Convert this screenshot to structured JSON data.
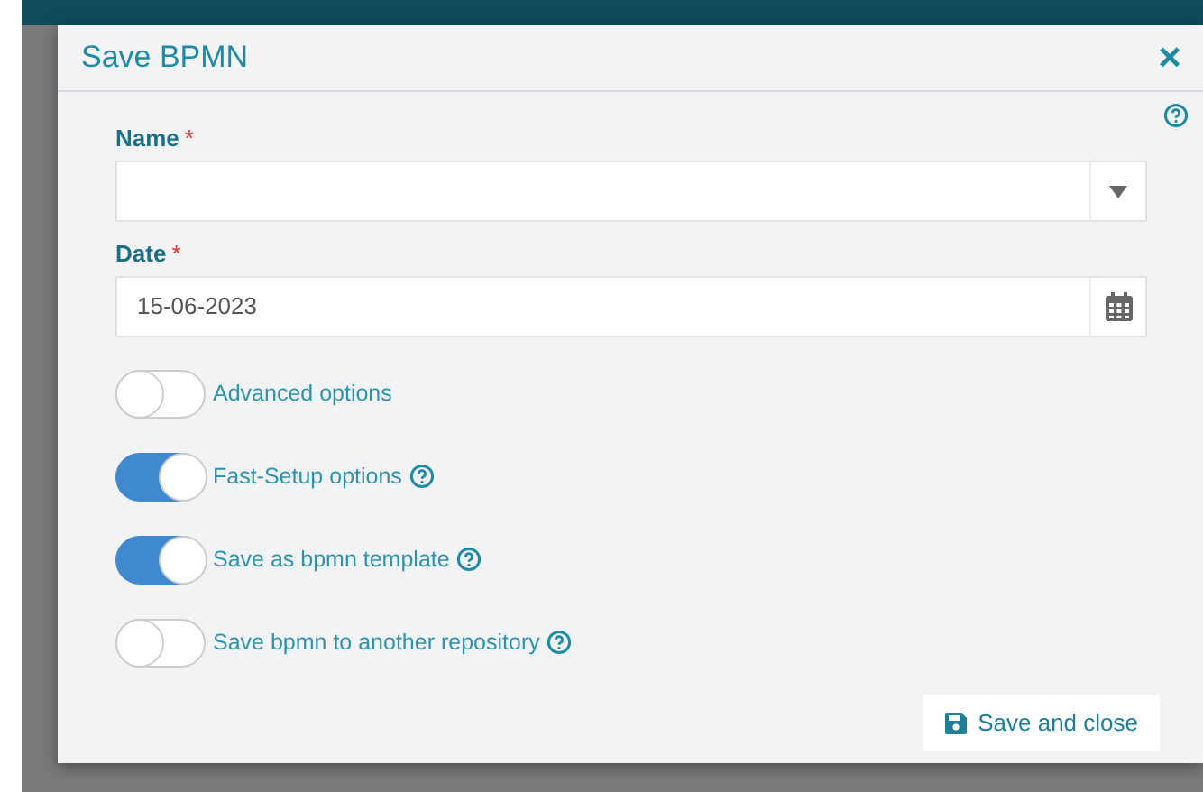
{
  "dialog": {
    "title": "Save BPMN",
    "close": "×"
  },
  "fields": [
    {
      "kind": "select",
      "label": "Name",
      "required_mark": "*"
    },
    {
      "kind": "date",
      "label": "Date",
      "required_mark": "*",
      "value": "15-06-2023"
    }
  ],
  "toggles": [
    {
      "label": "Advanced options",
      "on": false
    },
    {
      "label": "Fast-Setup options",
      "on": true,
      "help": true
    },
    {
      "label": "Save as bpmn template",
      "on": true,
      "help": true
    },
    {
      "label": "Save bpmn to another repository",
      "on": false,
      "help": true
    }
  ],
  "buttons": [
    {
      "label": "Save and close"
    }
  ]
}
